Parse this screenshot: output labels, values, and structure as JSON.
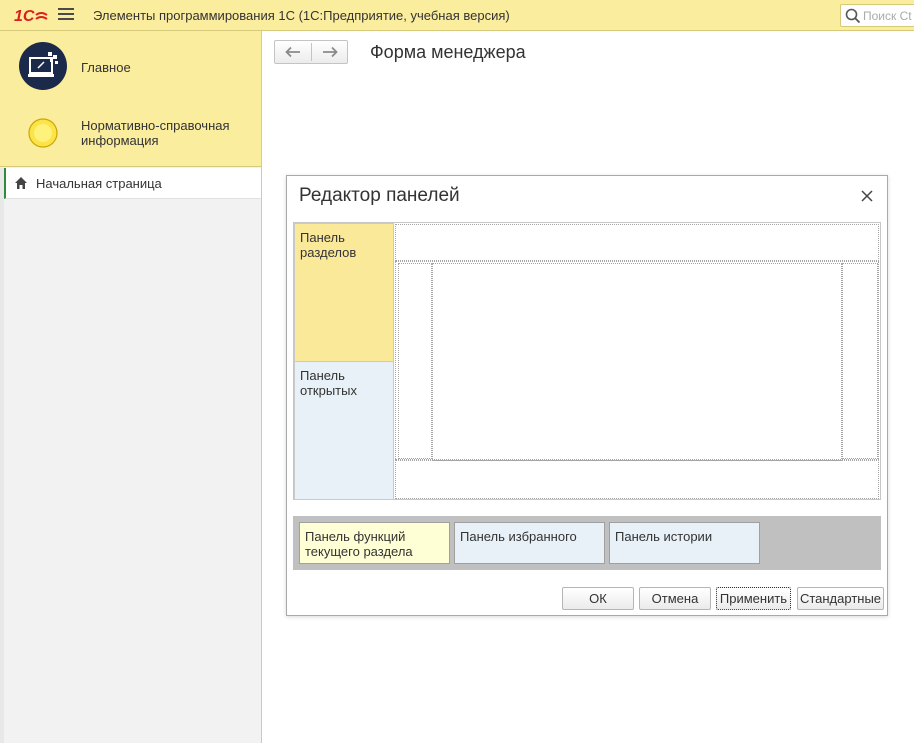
{
  "app": {
    "title": "Элементы программирования 1С  (1С:Предприятие, учебная версия)",
    "search_placeholder": "Поиск Ct"
  },
  "sidebar": {
    "sections": [
      {
        "label": "Главное",
        "icon": "desktop-icon"
      },
      {
        "label": "Нормативно-справочная информация",
        "icon": "yellow-circle-icon"
      }
    ],
    "home": {
      "label": "Начальная страница",
      "icon": "home-icon"
    }
  },
  "main": {
    "form_title": "Форма менеджера"
  },
  "dialog": {
    "title": "Редактор панелей",
    "panels": {
      "sections": "Панель разделов",
      "open": "Панель открытых",
      "functions": "Панель функций текущего раздела",
      "favorites": "Панель избранного",
      "history": "Панель истории"
    },
    "buttons": {
      "ok": "ОК",
      "cancel": "Отмена",
      "apply": "Применить",
      "default": "Стандартные"
    }
  },
  "colors": {
    "accent_yellow": "#fbed9e",
    "sections_panel": "#fbe99a",
    "open_panel": "#e7f1f7",
    "functions_panel": "#ffffd6",
    "bottom_strip": "#c0c0c0",
    "logo_red": "#d9201f",
    "home_marker": "#2f8a3e"
  }
}
